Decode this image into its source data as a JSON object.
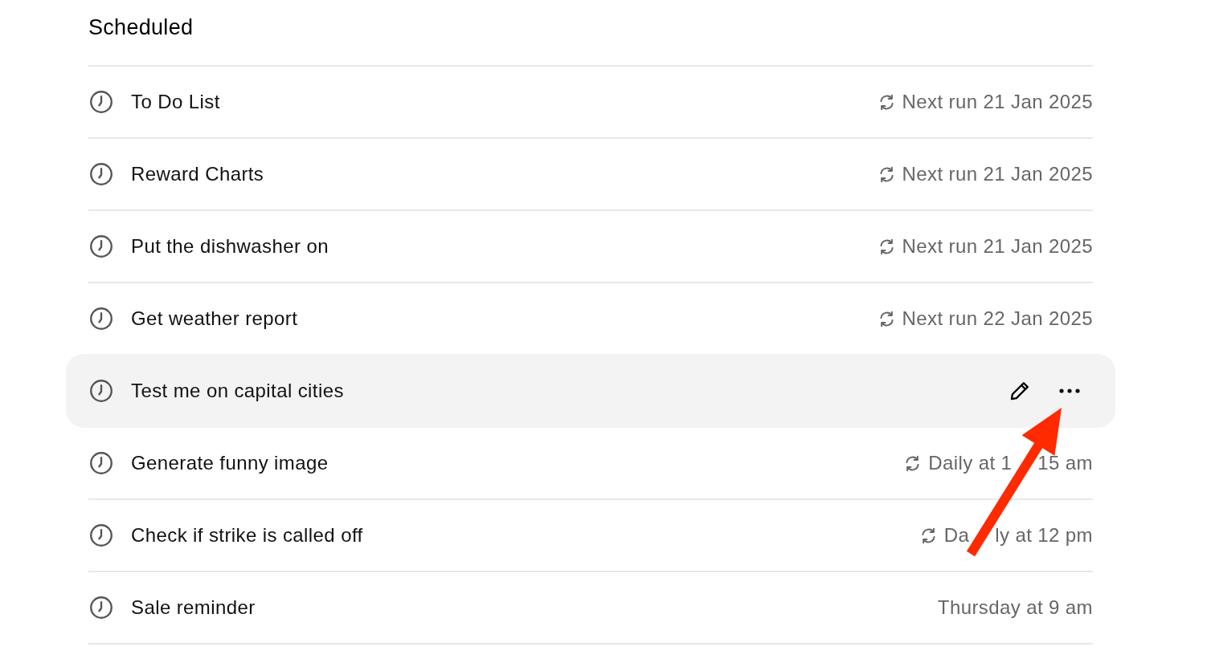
{
  "header": {
    "title": "Scheduled"
  },
  "tasks": [
    {
      "title": "To Do List",
      "schedule": [
        "Next run 21 Jan 2025"
      ],
      "repeating": true,
      "highlighted": false
    },
    {
      "title": "Reward Charts",
      "schedule": [
        "Next run 21 Jan 2025"
      ],
      "repeating": true,
      "highlighted": false
    },
    {
      "title": "Put the dishwasher on",
      "schedule": [
        "Next run 21 Jan 2025"
      ],
      "repeating": true,
      "highlighted": false
    },
    {
      "title": "Get weather report",
      "schedule": [
        "Next run 22 Jan 2025"
      ],
      "repeating": true,
      "highlighted": false
    },
    {
      "title": "Test me on capital cities",
      "highlighted": true,
      "actions": [
        {
          "kind": "edit"
        },
        {
          "kind": "more"
        }
      ]
    },
    {
      "title": "Generate funny image",
      "schedule": [
        "Daily at 1",
        "15 am"
      ],
      "repeating": true,
      "highlighted": false
    },
    {
      "title": "Check if strike is called off",
      "schedule": [
        "Da",
        "ly at 12 pm"
      ],
      "repeating": true,
      "highlighted": false
    },
    {
      "title": "Sale reminder",
      "schedule": [
        "Thursday at 9 am"
      ],
      "repeating": false,
      "highlighted": false
    }
  ],
  "annotation": {
    "kind": "arrow"
  }
}
